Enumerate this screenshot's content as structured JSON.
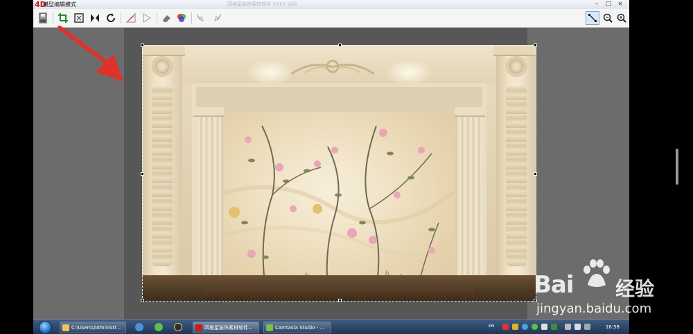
{
  "window": {
    "logo": "4D",
    "title": "模型编辑模式",
    "center_title": "四维星装饰素材软件   XXXX 以后",
    "minimize": "–",
    "restore": "□",
    "close": "×"
  },
  "toolbar": {
    "icons": [
      "save-icon",
      "crop-icon",
      "fit-icon",
      "flip-icon",
      "rotate-icon",
      "perspective-icon",
      "mirror-icon",
      "eraser-icon",
      "color-icon",
      "bird-left-icon",
      "bird-right-icon",
      "select-tool-icon",
      "zoom-out-icon",
      "zoom-in-icon"
    ]
  },
  "taskbar": {
    "buttons": [
      {
        "label": "C:\\Users\\Administr..."
      },
      {
        "label": "四维星装饰素材软件..."
      },
      {
        "label": "Camtasia Studio - ..."
      }
    ],
    "tray_lang": "EN",
    "clock": "16:58"
  },
  "watermark": {
    "brand": "Bai",
    "cn": "经验",
    "url": "jingyan.baidu.com"
  },
  "colors": {
    "arrow": "#e0312a",
    "accent": "#2c78c8"
  }
}
